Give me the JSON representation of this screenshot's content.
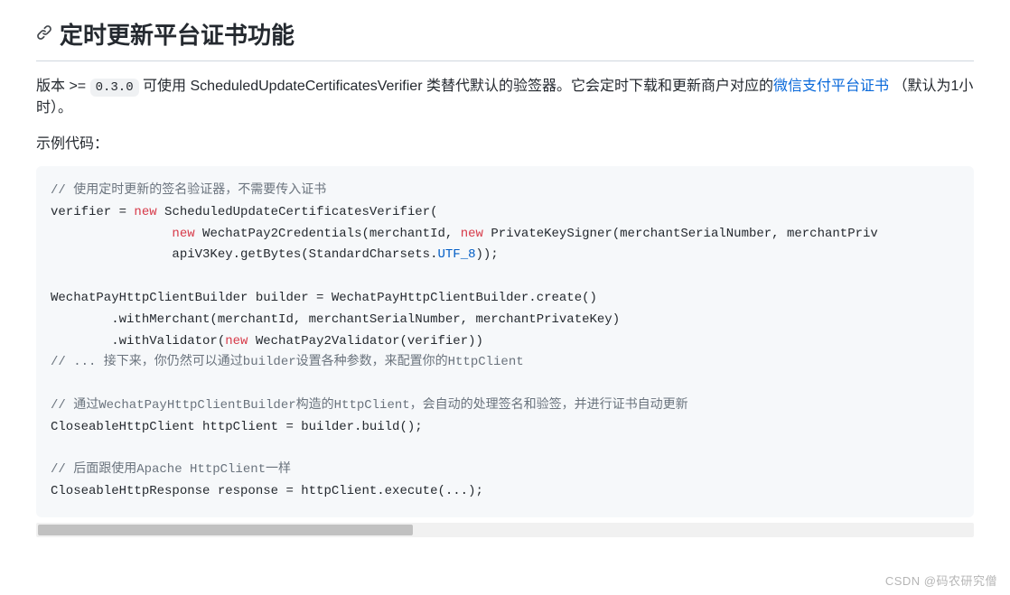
{
  "heading": "定时更新平台证书功能",
  "description": {
    "prefix": "版本 >= ",
    "version_code": "0.3.0",
    "mid": " 可使用 ScheduledUpdateCertificatesVerifier 类替代默认的验签器。它会定时下载和更新商户对应的",
    "link_text": "微信支付平台证书",
    "suffix": " （默认为1小时）。"
  },
  "example_label": "示例代码：",
  "code": {
    "c1": "// 使用定时更新的签名验证器，不需要传入证书",
    "l2a": "verifier = ",
    "kw_new": "new",
    "l2b": " ScheduledUpdateCertificatesVerifier(",
    "l3a": "                ",
    "l3b": " WechatPay2Credentials(merchantId, ",
    "l3c": " PrivateKeySigner(merchantSerialNumber, merchantPriv",
    "l4a": "                apiV3Key.getBytes(StandardCharsets.",
    "utf8": "UTF_8",
    "l4b": "));",
    "blank": "",
    "l5": "WechatPayHttpClientBuilder builder = WechatPayHttpClientBuilder.create()",
    "l6": "        .withMerchant(merchantId, merchantSerialNumber, merchantPrivateKey)",
    "l7a": "        .withValidator(",
    "l7b": " WechatPay2Validator(verifier))",
    "c2": "// ... 接下来，你仍然可以通过builder设置各种参数，来配置你的HttpClient",
    "c3": "// 通过WechatPayHttpClientBuilder构造的HttpClient，会自动的处理签名和验签，并进行证书自动更新",
    "l8": "CloseableHttpClient httpClient = builder.build();",
    "c4": "// 后面跟使用Apache HttpClient一样",
    "l9": "CloseableHttpResponse response = httpClient.execute(...);"
  },
  "watermark": "CSDN @码农研究僧"
}
